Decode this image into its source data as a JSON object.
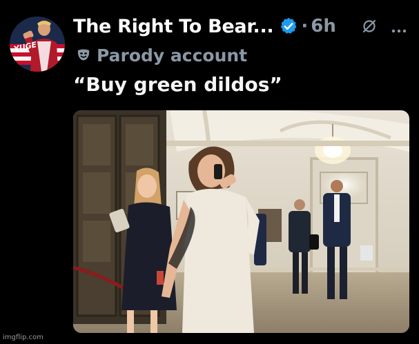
{
  "post": {
    "author_name": "The Right To Bear...",
    "separator": "·",
    "timestamp": "6h",
    "account_label": "Parody account",
    "text": "“Buy green dildos”",
    "avatar_text": "YUGE"
  },
  "icons": {
    "verified": "verified-badge-icon",
    "parody": "theater-mask-icon",
    "grok": "grok-slash-icon",
    "more": "more-horizontal-icon"
  },
  "colors": {
    "background": "#000000",
    "name": "#ffffff",
    "secondary": "#8b98a5",
    "verified": "#1d9bf0"
  },
  "watermark": "imgflip.com"
}
